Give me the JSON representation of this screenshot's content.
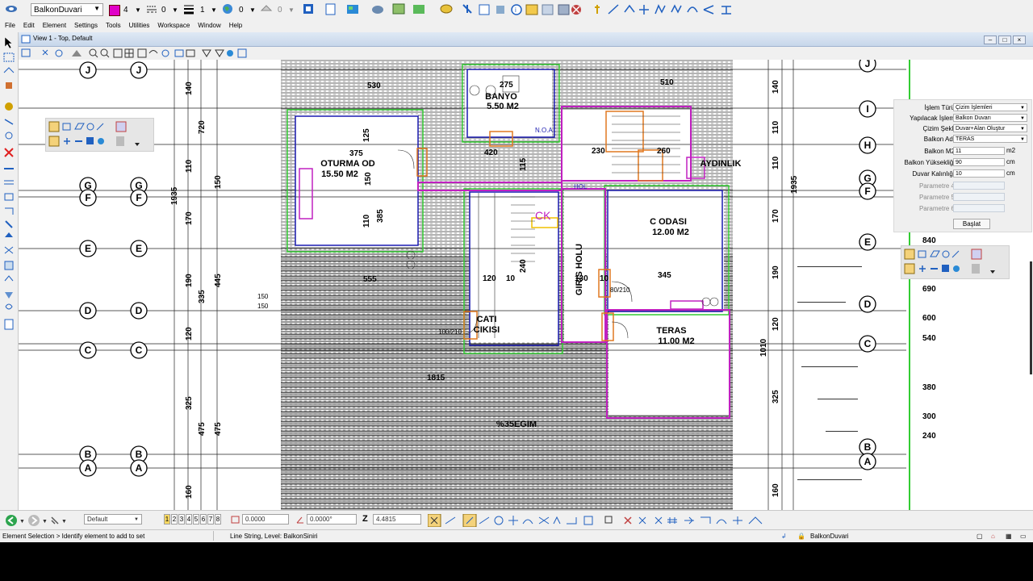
{
  "toolbar": {
    "level_combo": "BalkonDuvari",
    "color_value": "4",
    "linestyle_value": "0",
    "weight_value": "1",
    "transparency_value": "0",
    "priority_value": "0",
    "color_swatch": "#e000c8"
  },
  "menu": {
    "items": [
      "File",
      "Edit",
      "Element",
      "Settings",
      "Tools",
      "Utilities",
      "Workspace",
      "Window",
      "Help"
    ]
  },
  "view": {
    "title": "View 1 - Top, Default"
  },
  "drawing": {
    "grid_labels_left": [
      "J",
      "G",
      "F",
      "E",
      "D",
      "C",
      "B",
      "A"
    ],
    "grid_labels_right": [
      "J",
      "I",
      "H",
      "G",
      "F",
      "E",
      "D",
      "C",
      "B",
      "A"
    ],
    "rooms": [
      {
        "name": "BANYO",
        "area": "5.50 M2"
      },
      {
        "name": "OTURMA OD",
        "area": "15.50 M2"
      },
      {
        "name": "C ODASI",
        "area": "12.00 M2"
      },
      {
        "name": "TERAS",
        "area": "11.00 M2"
      },
      {
        "name": "GIRIS HOLU",
        "area": ""
      },
      {
        "name": "CATI",
        "area": "CIKISI"
      },
      {
        "name": "AYDINLIK",
        "area": ""
      },
      {
        "name": "%35EGIM",
        "area": ""
      }
    ],
    "dimensions_top": [
      "530",
      "275",
      "510",
      "375",
      "125",
      "420",
      "230",
      "260",
      "555",
      "345",
      "120",
      "10",
      "10",
      "130",
      "1815",
      "385",
      "110",
      "150",
      "115",
      "240"
    ],
    "dimensions_left": [
      "140",
      "720",
      "110",
      "1935",
      "150",
      "170",
      "445",
      "190",
      "335",
      "120",
      "325",
      "475",
      "475",
      "160"
    ],
    "dimensions_right": [
      "140",
      "110",
      "110",
      "1935",
      "170",
      "190",
      "120",
      "1010",
      "325",
      "160"
    ],
    "labels_misc": [
      "CK",
      "N.O.A",
      "HOL",
      "80/210",
      "100/210",
      "150",
      "150"
    ],
    "levels_right": [
      "840",
      "690",
      "600",
      "540",
      "380",
      "300",
      "240"
    ]
  },
  "panel": {
    "rows": [
      {
        "label": "İşlem Türü",
        "value": "Çizim İşlemleri",
        "type": "combo"
      },
      {
        "label": "Yapılacak İşlem",
        "value": "Balkon Duvarı",
        "type": "combo"
      },
      {
        "label": "Çizim Şekli",
        "value": "Duvar+Alan Oluştur",
        "type": "combo"
      },
      {
        "label": "Balkon Adı",
        "value": "TERAS",
        "type": "combo"
      },
      {
        "label": "Balkon M2",
        "value": "11",
        "unit": "m2",
        "type": "input"
      },
      {
        "label": "Balkon Yüksekliği",
        "value": "90",
        "unit": "cm",
        "type": "input"
      },
      {
        "label": "Duvar Kalınlığı",
        "value": "10",
        "unit": "cm",
        "type": "input"
      },
      {
        "label": "Parametre 4",
        "value": "",
        "type": "disabled"
      },
      {
        "label": "Parametre 5",
        "value": "",
        "type": "disabled"
      },
      {
        "label": "Parametre 6",
        "value": "",
        "type": "disabled"
      }
    ],
    "start_button": "Başlat"
  },
  "bottom": {
    "view_combo": "Default",
    "view_tabs": [
      "1",
      "2",
      "3",
      "4",
      "5",
      "6",
      "7",
      "8"
    ],
    "x_field": "0.0000",
    "angle_field": "0.0000°",
    "z_label": "Z",
    "z_field": "4.4815"
  },
  "status": {
    "left": "Element Selection > Identify element to add to set",
    "middle": "Line String, Level: BalkonSiniri",
    "right": "BalkonDuvari"
  }
}
